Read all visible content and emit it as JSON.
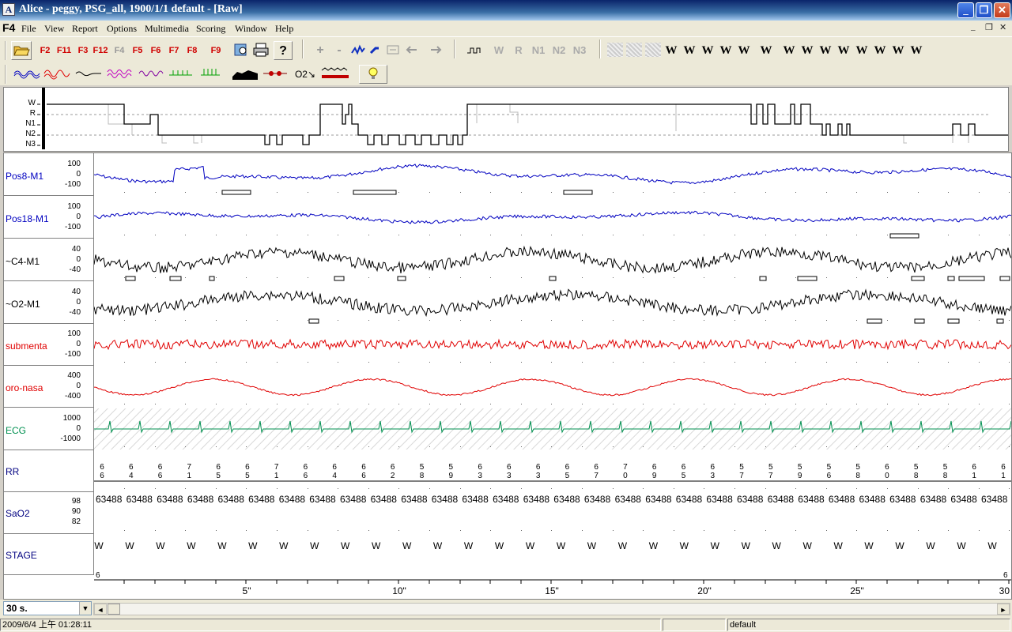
{
  "window": {
    "app_icon": "A",
    "title": "Alice - peggy, PSG_all, 1900/1/1 default - [Raw]",
    "controls": [
      "_",
      "❐",
      "✕"
    ]
  },
  "menubar": {
    "brand": "F4",
    "items": [
      "File",
      "View",
      "Report",
      "Options",
      "Multimedia",
      "Scoring",
      "Window",
      "Help"
    ],
    "mdi_controls": [
      "_",
      "❐",
      "✕"
    ]
  },
  "toolbar1": {
    "function_keys": [
      "F2",
      "F11",
      "F3",
      "F12",
      "F4",
      "F5",
      "F6",
      "F7",
      "F8",
      "F9"
    ],
    "disabled_function_keys": [
      "F4"
    ],
    "nav_buttons": [
      "+",
      "-"
    ],
    "stage_buttons_disabled": [
      "W",
      "R",
      "N1",
      "N2",
      "N3"
    ],
    "w_buttons": [
      "W",
      "W",
      "W",
      "W",
      "W",
      "W",
      "W",
      "W",
      "W",
      "W",
      "W",
      "W",
      "W",
      "W"
    ]
  },
  "toolbar2": {
    "o2_label": "O2↘"
  },
  "hypnogram": {
    "stages": [
      "W",
      "R",
      "N1",
      "N2",
      "N3"
    ]
  },
  "channels": [
    {
      "name": "Pos8-M1",
      "color": "#0000c0",
      "ticks": [
        "100",
        "0",
        "-100"
      ]
    },
    {
      "name": "Pos18-M1",
      "color": "#0000c0",
      "ticks": [
        "100",
        "0",
        "-100"
      ]
    },
    {
      "name": "~C4-M1",
      "color": "#000000",
      "ticks": [
        "40",
        "0",
        "-40"
      ]
    },
    {
      "name": "~O2-M1",
      "color": "#000000",
      "ticks": [
        "40",
        "0",
        "-40"
      ]
    },
    {
      "name": "submenta",
      "color": "#e00000",
      "ticks": [
        "100",
        "0",
        "-100"
      ]
    },
    {
      "name": "oro-nasa",
      "color": "#e00000",
      "ticks": [
        "400",
        "0",
        "-400"
      ]
    },
    {
      "name": "ECG",
      "color": "#009050",
      "ticks": [
        "1000",
        "0",
        "-1000"
      ]
    },
    {
      "name": "RR",
      "color": "#000000",
      "ticks": []
    },
    {
      "name": "SaO2",
      "color": "#000080",
      "ticks": [
        "98",
        "90",
        "82"
      ]
    },
    {
      "name": "STAGE",
      "color": "#000080",
      "ticks": []
    }
  ],
  "rr_values": [
    [
      "6",
      "6"
    ],
    [
      "6",
      "4"
    ],
    [
      "6",
      "6"
    ],
    [
      "7",
      "1"
    ],
    [
      "6",
      "5"
    ],
    [
      "6",
      "5"
    ],
    [
      "7",
      "1"
    ],
    [
      "6",
      "6"
    ],
    [
      "6",
      "4"
    ],
    [
      "6",
      "6"
    ],
    [
      "6",
      "2"
    ],
    [
      "5",
      "8"
    ],
    [
      "5",
      "9"
    ],
    [
      "6",
      "3"
    ],
    [
      "6",
      "3"
    ],
    [
      "6",
      "3"
    ],
    [
      "6",
      "5"
    ],
    [
      "6",
      "7"
    ],
    [
      "7",
      "0"
    ],
    [
      "6",
      "9"
    ],
    [
      "6",
      "5"
    ],
    [
      "6",
      "3"
    ],
    [
      "5",
      "7"
    ],
    [
      "5",
      "7"
    ],
    [
      "5",
      "9"
    ],
    [
      "5",
      "6"
    ],
    [
      "5",
      "8"
    ],
    [
      "6",
      "0"
    ],
    [
      "5",
      "8"
    ],
    [
      "5",
      "8"
    ],
    [
      "6",
      "1"
    ],
    [
      "6",
      "1"
    ]
  ],
  "sao2_values": [
    "63488",
    "63488",
    "63488",
    "63488",
    "63488",
    "63488",
    "63488",
    "63488",
    "63488",
    "63488",
    "63488",
    "63488",
    "63488",
    "63488",
    "63488",
    "63488",
    "63488",
    "63488",
    "63488",
    "63488",
    "63488",
    "63488",
    "63488",
    "63488",
    "63488",
    "63488",
    "63488",
    "63488",
    "63488",
    "63488"
  ],
  "stage_values": [
    "W",
    "W",
    "W",
    "W",
    "W",
    "W",
    "W",
    "W",
    "W",
    "W",
    "W",
    "W",
    "W",
    "W",
    "W",
    "W",
    "W",
    "W",
    "W",
    "W",
    "W",
    "W",
    "W",
    "W",
    "W",
    "W",
    "W",
    "W",
    "W",
    "W"
  ],
  "stage_corner_left": "6",
  "stage_corner_right": "6",
  "time_axis": [
    "5\"",
    "10\"",
    "15\"",
    "20\"",
    "25\"",
    "30"
  ],
  "epoch": {
    "value": "30 s.",
    "arrow": "▼"
  },
  "scroll": {
    "left_arrow": "◄",
    "right_arrow": "►"
  },
  "status": {
    "datetime": "2009/6/4 上午 01:28:11",
    "montage": "default"
  }
}
